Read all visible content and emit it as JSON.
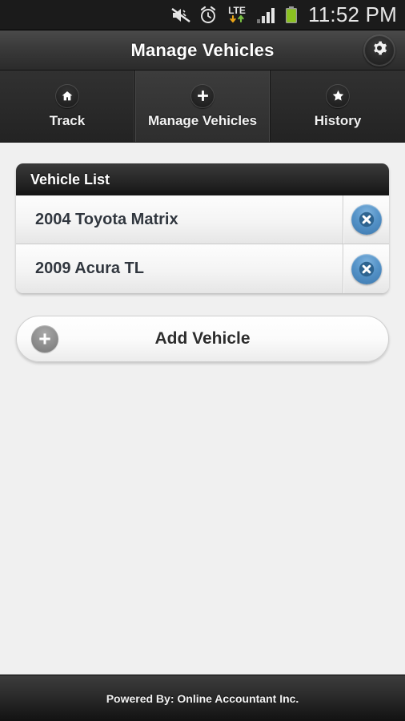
{
  "statusbar": {
    "time": "11:52 PM",
    "icons": [
      {
        "name": "mute-vibrate-icon",
        "label": "silent"
      },
      {
        "name": "alarm-clock-icon",
        "label": "alarm"
      },
      {
        "name": "lte-data-icon",
        "label": "LTE"
      },
      {
        "name": "signal-bars-icon",
        "label": "signal"
      },
      {
        "name": "battery-icon",
        "label": "battery"
      }
    ],
    "lte_label": "LTE",
    "background": "#1b1b1b",
    "battery_color": "#8bc220",
    "data_down_color": "#e8a317",
    "data_up_color": "#7ac143"
  },
  "titlebar": {
    "title": "Manage Vehicles",
    "settings_icon": "gear-icon"
  },
  "tabs": [
    {
      "label": "Track",
      "icon": "home-icon",
      "active": false
    },
    {
      "label": "Manage Vehicles",
      "icon": "plus-icon",
      "active": true
    },
    {
      "label": "History",
      "icon": "star-icon",
      "active": false
    }
  ],
  "main": {
    "card_title": "Vehicle List",
    "vehicles": [
      {
        "name": "2004 Toyota Matrix",
        "delete_icon": "close-circle-icon"
      },
      {
        "name": "2009 Acura TL",
        "delete_icon": "close-circle-icon"
      }
    ],
    "add_button": {
      "label": "Add Vehicle",
      "icon": "plus-circle-icon"
    }
  },
  "footer": {
    "text": "Powered By: Online Accountant Inc."
  },
  "colors": {
    "page_background": "#f0f0f0",
    "delete_blue": "#4a86c0",
    "text_dark": "#31373f"
  }
}
